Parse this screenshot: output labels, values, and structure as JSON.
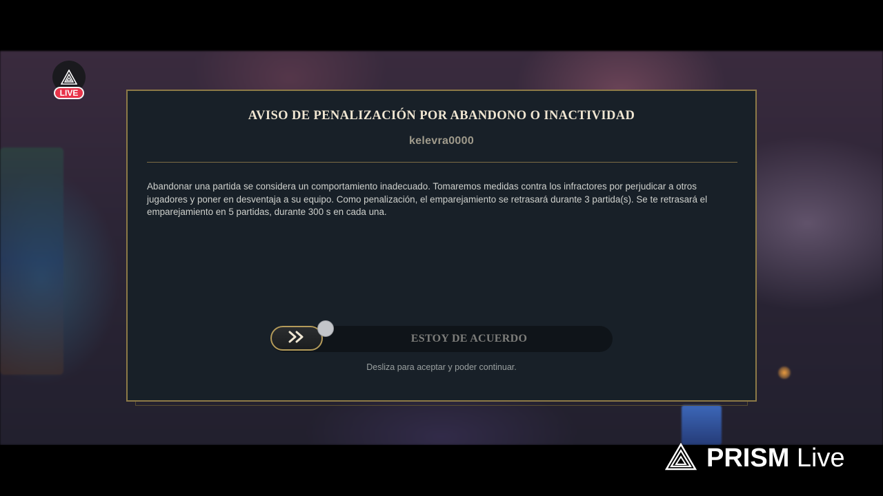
{
  "overlay": {
    "live_label": "LIVE"
  },
  "dialog": {
    "title": "AVISO DE PENALIZACIÓN POR ABANDONO O INACTIVIDAD",
    "username": "kelevra0000",
    "body": "Abandonar una partida se considera un comportamiento inadecuado. Tomaremos medidas contra los infractores por perjudicar a otros jugadores y poner en desventaja a su equipo. Como penalización, el emparejamiento se retrasará durante 3 partida(s). Se te retrasará el emparejamiento en 5 partidas, durante 300 s en cada una.",
    "slider_label": "ESTOY DE ACUERDO",
    "slider_hint": "Desliza para aceptar y poder continuar.",
    "slider_icon": "double-chevron-right-icon"
  },
  "watermark": {
    "brand": "PRISM",
    "suffix": "Live"
  },
  "colors": {
    "accent_gold": "#8d7a47",
    "dialog_bg": "#182028",
    "live_red": "#e8344a"
  }
}
